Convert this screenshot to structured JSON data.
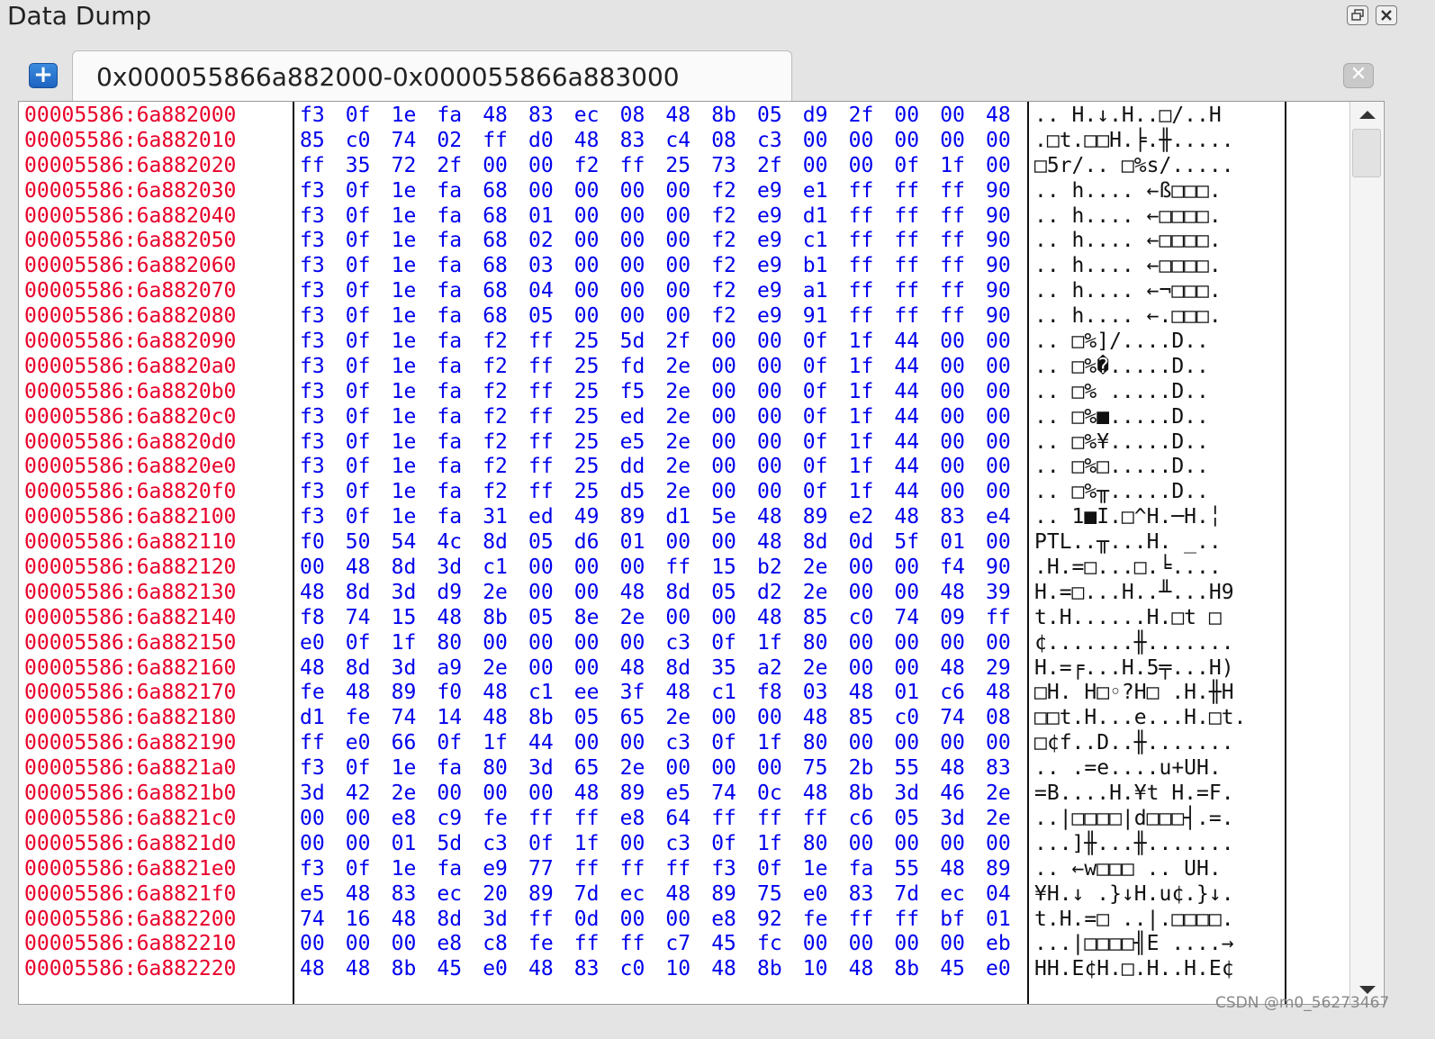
{
  "panel": {
    "title": "Data Dump"
  },
  "tab": {
    "label": "0x000055866a882000-0x000055866a883000"
  },
  "watermark": "CSDN @m0_56273467",
  "rows": [
    {
      "addr": "00005586:6a882000",
      "bytes": [
        "f3",
        "0f",
        "1e",
        "fa",
        "48",
        "83",
        "ec",
        "08",
        "48",
        "8b",
        "05",
        "d9",
        "2f",
        "00",
        "00",
        "48"
      ],
      "ascii": " .. H.↓.H..□/..H"
    },
    {
      "addr": "00005586:6a882010",
      "bytes": [
        "85",
        "c0",
        "74",
        "02",
        "ff",
        "d0",
        "48",
        "83",
        "c4",
        "08",
        "c3",
        "00",
        "00",
        "00",
        "00",
        "00"
      ],
      "ascii": ".□t.□□H.╞.╫....."
    },
    {
      "addr": "00005586:6a882020",
      "bytes": [
        "ff",
        "35",
        "72",
        "2f",
        "00",
        "00",
        "f2",
        "ff",
        "25",
        "73",
        "2f",
        "00",
        "00",
        "0f",
        "1f",
        "00"
      ],
      "ascii": "□5r/.. □%s/....."
    },
    {
      "addr": "00005586:6a882030",
      "bytes": [
        "f3",
        "0f",
        "1e",
        "fa",
        "68",
        "00",
        "00",
        "00",
        "00",
        "f2",
        "e9",
        "e1",
        "ff",
        "ff",
        "ff",
        "90"
      ],
      "ascii": " .. h.... ←ß□□□."
    },
    {
      "addr": "00005586:6a882040",
      "bytes": [
        "f3",
        "0f",
        "1e",
        "fa",
        "68",
        "01",
        "00",
        "00",
        "00",
        "f2",
        "e9",
        "d1",
        "ff",
        "ff",
        "ff",
        "90"
      ],
      "ascii": " .. h.... ←□□□□."
    },
    {
      "addr": "00005586:6a882050",
      "bytes": [
        "f3",
        "0f",
        "1e",
        "fa",
        "68",
        "02",
        "00",
        "00",
        "00",
        "f2",
        "e9",
        "c1",
        "ff",
        "ff",
        "ff",
        "90"
      ],
      "ascii": " .. h.... ←□□□□."
    },
    {
      "addr": "00005586:6a882060",
      "bytes": [
        "f3",
        "0f",
        "1e",
        "fa",
        "68",
        "03",
        "00",
        "00",
        "00",
        "f2",
        "e9",
        "b1",
        "ff",
        "ff",
        "ff",
        "90"
      ],
      "ascii": " .. h.... ←□□□□."
    },
    {
      "addr": "00005586:6a882070",
      "bytes": [
        "f3",
        "0f",
        "1e",
        "fa",
        "68",
        "04",
        "00",
        "00",
        "00",
        "f2",
        "e9",
        "a1",
        "ff",
        "ff",
        "ff",
        "90"
      ],
      "ascii": " .. h.... ←¬□□□."
    },
    {
      "addr": "00005586:6a882080",
      "bytes": [
        "f3",
        "0f",
        "1e",
        "fa",
        "68",
        "05",
        "00",
        "00",
        "00",
        "f2",
        "e9",
        "91",
        "ff",
        "ff",
        "ff",
        "90"
      ],
      "ascii": " .. h.... ←.□□□."
    },
    {
      "addr": "00005586:6a882090",
      "bytes": [
        "f3",
        "0f",
        "1e",
        "fa",
        "f2",
        "ff",
        "25",
        "5d",
        "2f",
        "00",
        "00",
        "0f",
        "1f",
        "44",
        "00",
        "00"
      ],
      "ascii": " ..   □%]/....D.."
    },
    {
      "addr": "00005586:6a8820a0",
      "bytes": [
        "f3",
        "0f",
        "1e",
        "fa",
        "f2",
        "ff",
        "25",
        "fd",
        "2e",
        "00",
        "00",
        "0f",
        "1f",
        "44",
        "00",
        "00"
      ],
      "ascii": " ..   □%�.....D.."
    },
    {
      "addr": "00005586:6a8820b0",
      "bytes": [
        "f3",
        "0f",
        "1e",
        "fa",
        "f2",
        "ff",
        "25",
        "f5",
        "2e",
        "00",
        "00",
        "0f",
        "1f",
        "44",
        "00",
        "00"
      ],
      "ascii": " ..   □% .....D.."
    },
    {
      "addr": "00005586:6a8820c0",
      "bytes": [
        "f3",
        "0f",
        "1e",
        "fa",
        "f2",
        "ff",
        "25",
        "ed",
        "2e",
        "00",
        "00",
        "0f",
        "1f",
        "44",
        "00",
        "00"
      ],
      "ascii": " ..   □%■.....D.."
    },
    {
      "addr": "00005586:6a8820d0",
      "bytes": [
        "f3",
        "0f",
        "1e",
        "fa",
        "f2",
        "ff",
        "25",
        "e5",
        "2e",
        "00",
        "00",
        "0f",
        "1f",
        "44",
        "00",
        "00"
      ],
      "ascii": " ..   □%¥.....D.."
    },
    {
      "addr": "00005586:6a8820e0",
      "bytes": [
        "f3",
        "0f",
        "1e",
        "fa",
        "f2",
        "ff",
        "25",
        "dd",
        "2e",
        "00",
        "00",
        "0f",
        "1f",
        "44",
        "00",
        "00"
      ],
      "ascii": " ..   □%□.....D.."
    },
    {
      "addr": "00005586:6a8820f0",
      "bytes": [
        "f3",
        "0f",
        "1e",
        "fa",
        "f2",
        "ff",
        "25",
        "d5",
        "2e",
        "00",
        "00",
        "0f",
        "1f",
        "44",
        "00",
        "00"
      ],
      "ascii": " ..   □%╥.....D.."
    },
    {
      "addr": "00005586:6a882100",
      "bytes": [
        "f3",
        "0f",
        "1e",
        "fa",
        "31",
        "ed",
        "49",
        "89",
        "d1",
        "5e",
        "48",
        "89",
        "e2",
        "48",
        "83",
        "e4"
      ],
      "ascii": " ..  1■I.□^H.─H.╎"
    },
    {
      "addr": "00005586:6a882110",
      "bytes": [
        "f0",
        "50",
        "54",
        "4c",
        "8d",
        "05",
        "d6",
        "01",
        "00",
        "00",
        "48",
        "8d",
        "0d",
        "5f",
        "01",
        "00"
      ],
      "ascii": " PTL..╥...H. _.."
    },
    {
      "addr": "00005586:6a882120",
      "bytes": [
        "00",
        "48",
        "8d",
        "3d",
        "c1",
        "00",
        "00",
        "00",
        "ff",
        "15",
        "b2",
        "2e",
        "00",
        "00",
        "f4",
        "90"
      ],
      "ascii": ".H.=□...□.╘.... "
    },
    {
      "addr": "00005586:6a882130",
      "bytes": [
        "48",
        "8d",
        "3d",
        "d9",
        "2e",
        "00",
        "00",
        "48",
        "8d",
        "05",
        "d2",
        "2e",
        "00",
        "00",
        "48",
        "39"
      ],
      "ascii": "H.=□...H..╨...H9"
    },
    {
      "addr": "00005586:6a882140",
      "bytes": [
        "f8",
        "74",
        "15",
        "48",
        "8b",
        "05",
        "8e",
        "2e",
        "00",
        "00",
        "48",
        "85",
        "c0",
        "74",
        "09",
        "ff"
      ],
      "ascii": " t.H......H.□t □"
    },
    {
      "addr": "00005586:6a882150",
      "bytes": [
        "e0",
        "0f",
        "1f",
        "80",
        "00",
        "00",
        "00",
        "00",
        "c3",
        "0f",
        "1f",
        "80",
        "00",
        "00",
        "00",
        "00"
      ],
      "ascii": "¢.......╫......."
    },
    {
      "addr": "00005586:6a882160",
      "bytes": [
        "48",
        "8d",
        "3d",
        "a9",
        "2e",
        "00",
        "00",
        "48",
        "8d",
        "35",
        "a2",
        "2e",
        "00",
        "00",
        "48",
        "29"
      ],
      "ascii": "H.=╒...H.5╤...H)"
    },
    {
      "addr": "00005586:6a882170",
      "bytes": [
        "fe",
        "48",
        "89",
        "f0",
        "48",
        "c1",
        "ee",
        "3f",
        "48",
        "c1",
        "f8",
        "03",
        "48",
        "01",
        "c6",
        "48"
      ],
      "ascii": "□H. H□◦?H□ .H.╫H"
    },
    {
      "addr": "00005586:6a882180",
      "bytes": [
        "d1",
        "fe",
        "74",
        "14",
        "48",
        "8b",
        "05",
        "65",
        "2e",
        "00",
        "00",
        "48",
        "85",
        "c0",
        "74",
        "08"
      ],
      "ascii": "□□t.H...e...H.□t."
    },
    {
      "addr": "00005586:6a882190",
      "bytes": [
        "ff",
        "e0",
        "66",
        "0f",
        "1f",
        "44",
        "00",
        "00",
        "c3",
        "0f",
        "1f",
        "80",
        "00",
        "00",
        "00",
        "00"
      ],
      "ascii": "□¢f..D..╫......."
    },
    {
      "addr": "00005586:6a8821a0",
      "bytes": [
        "f3",
        "0f",
        "1e",
        "fa",
        "80",
        "3d",
        "65",
        "2e",
        "00",
        "00",
        "00",
        "75",
        "2b",
        "55",
        "48",
        "83"
      ],
      "ascii": " ..  .=e....u+UH."
    },
    {
      "addr": "00005586:6a8821b0",
      "bytes": [
        "3d",
        "42",
        "2e",
        "00",
        "00",
        "00",
        "48",
        "89",
        "e5",
        "74",
        "0c",
        "48",
        "8b",
        "3d",
        "46",
        "2e"
      ],
      "ascii": "=B....H.¥t H.=F."
    },
    {
      "addr": "00005586:6a8821c0",
      "bytes": [
        "00",
        "00",
        "e8",
        "c9",
        "fe",
        "ff",
        "ff",
        "e8",
        "64",
        "ff",
        "ff",
        "ff",
        "c6",
        "05",
        "3d",
        "2e"
      ],
      "ascii": "..|□□□□|d□□□┤.=."
    },
    {
      "addr": "00005586:6a8821d0",
      "bytes": [
        "00",
        "00",
        "01",
        "5d",
        "c3",
        "0f",
        "1f",
        "00",
        "c3",
        "0f",
        "1f",
        "80",
        "00",
        "00",
        "00",
        "00"
      ],
      "ascii": "...]╫...╫......."
    },
    {
      "addr": "00005586:6a8821e0",
      "bytes": [
        "f3",
        "0f",
        "1e",
        "fa",
        "e9",
        "77",
        "ff",
        "ff",
        "ff",
        "f3",
        "0f",
        "1e",
        "fa",
        "55",
        "48",
        "89"
      ],
      "ascii": " .. ←w□□□ .. UH."
    },
    {
      "addr": "00005586:6a8821f0",
      "bytes": [
        "e5",
        "48",
        "83",
        "ec",
        "20",
        "89",
        "7d",
        "ec",
        "48",
        "89",
        "75",
        "e0",
        "83",
        "7d",
        "ec",
        "04"
      ],
      "ascii": "¥H.↓ .}↓H.u¢.}↓."
    },
    {
      "addr": "00005586:6a882200",
      "bytes": [
        "74",
        "16",
        "48",
        "8d",
        "3d",
        "ff",
        "0d",
        "00",
        "00",
        "e8",
        "92",
        "fe",
        "ff",
        "ff",
        "bf",
        "01"
      ],
      "ascii": "t.H.=□ ..|.□□□□."
    },
    {
      "addr": "00005586:6a882210",
      "bytes": [
        "00",
        "00",
        "00",
        "e8",
        "c8",
        "fe",
        "ff",
        "ff",
        "c7",
        "45",
        "fc",
        "00",
        "00",
        "00",
        "00",
        "eb"
      ],
      "ascii": "...|□□□□╢E ....→"
    },
    {
      "addr": "00005586:6a882220",
      "bytes": [
        "48",
        "48",
        "8b",
        "45",
        "e0",
        "48",
        "83",
        "c0",
        "10",
        "48",
        "8b",
        "10",
        "48",
        "8b",
        "45",
        "e0"
      ],
      "ascii": "HH.E¢H.□.H..H.E¢"
    }
  ]
}
